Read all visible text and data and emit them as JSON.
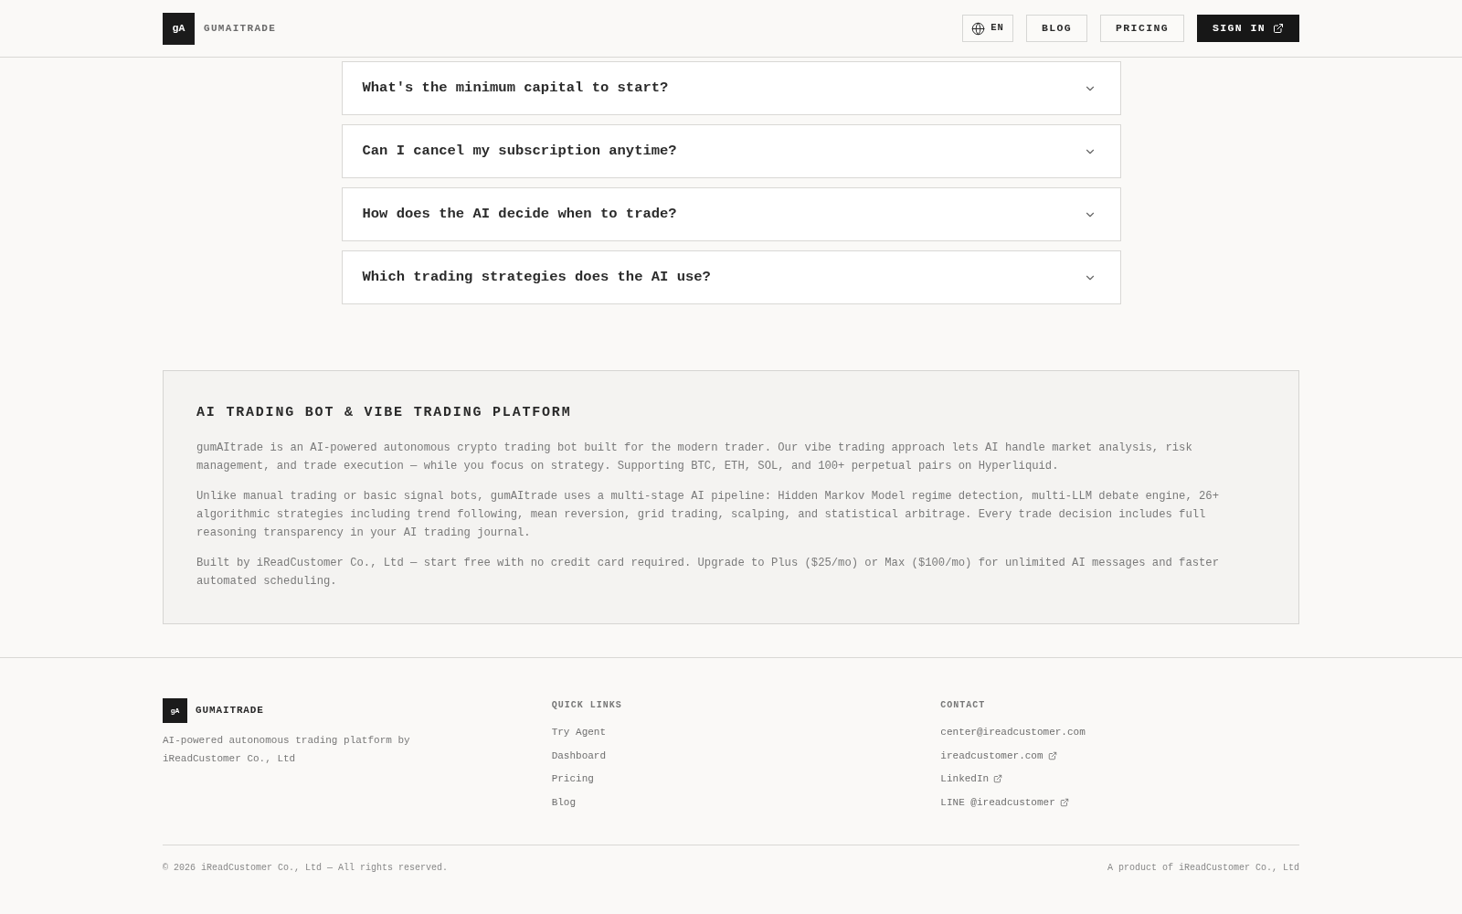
{
  "header": {
    "logo": {
      "mark": "gA",
      "name": "GUMAITRADE"
    },
    "language": "EN",
    "nav": [
      {
        "label": "BLOG",
        "kind": "outline",
        "external": false
      },
      {
        "label": "PRICING",
        "kind": "outline",
        "external": false
      },
      {
        "label": "SIGN IN",
        "kind": "solid",
        "external": true
      }
    ]
  },
  "faq": [
    {
      "question": "What's the minimum capital to start?",
      "expanded": false
    },
    {
      "question": "Can I cancel my subscription anytime?",
      "expanded": false
    },
    {
      "question": "How does the AI decide when to trade?",
      "expanded": false
    },
    {
      "question": "Which trading strategies does the AI use?",
      "expanded": false
    }
  ],
  "about": {
    "title": "AI TRADING BOT & VIBE TRADING PLATFORM",
    "paragraphs": [
      "gumAItrade is an AI-powered autonomous crypto trading bot built for the modern trader. Our vibe trading approach lets AI handle market analysis, risk management, and trade execution — while you focus on strategy. Supporting BTC, ETH, SOL, and 100+ perpetual pairs on Hyperliquid.",
      "Unlike manual trading or basic signal bots, gumAItrade uses a multi-stage AI pipeline: Hidden Markov Model regime detection, multi-LLM debate engine, 26+ algorithmic strategies including trend following, mean reversion, grid trading, scalping, and statistical arbitrage. Every trade decision includes full reasoning transparency in your AI trading journal.",
      "Built by iReadCustomer Co., Ltd — start free with no credit card required. Upgrade to Plus ($25/mo) or Max ($100/mo) for unlimited AI messages and faster automated scheduling."
    ]
  },
  "footer": {
    "brand": {
      "mark": "gA",
      "name": "GUMAITRADE",
      "description": "AI-powered autonomous trading platform by iReadCustomer Co., Ltd"
    },
    "columns": [
      {
        "heading": "QUICK LINKS",
        "links": [
          {
            "label": "Try Agent",
            "external": false
          },
          {
            "label": "Dashboard",
            "external": false
          },
          {
            "label": "Pricing",
            "external": false
          },
          {
            "label": "Blog",
            "external": false
          }
        ]
      },
      {
        "heading": "CONTACT",
        "links": [
          {
            "label": "center@ireadcustomer.com",
            "external": false
          },
          {
            "label": "ireadcustomer.com",
            "external": true
          },
          {
            "label": "LinkedIn",
            "external": true
          },
          {
            "label": "LINE @ireadcustomer",
            "external": true
          }
        ]
      }
    ],
    "copyright": "© 2026 iReadCustomer Co., Ltd — All rights reserved.",
    "credit": "A product of iReadCustomer Co., Ltd"
  }
}
